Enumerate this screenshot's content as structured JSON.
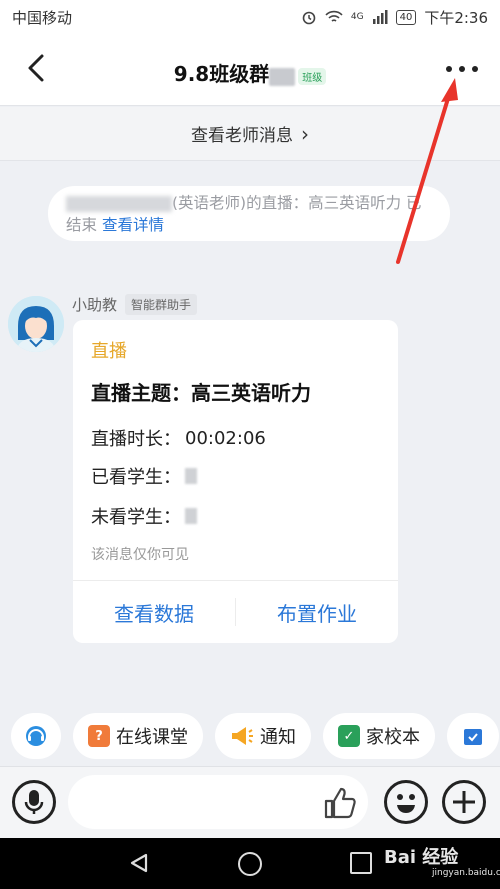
{
  "status": {
    "carrier": "中国移动",
    "battery": "40",
    "time": "下午2:36",
    "network": "4G"
  },
  "header": {
    "title": "9.8班级群",
    "class_tag": "班级"
  },
  "teacher_bar": {
    "label": "查看老师消息",
    "chevron": "›"
  },
  "notice": {
    "text": "(英语老师)的直播：高三英语听力 已结束",
    "link": "查看详情"
  },
  "message": {
    "sender": "小助教",
    "sender_tag": "智能群助手",
    "card_tag": "直播",
    "card_title": "直播主题：高三英语听力",
    "duration_label": "直播时长：",
    "duration_value": "00:02:06",
    "watched_label": "已看学生：",
    "unwatched_label": "未看学生：",
    "note": "该消息仅你可见",
    "action_data": "查看数据",
    "action_homework": "布置作业"
  },
  "quickbar": {
    "items": [
      {
        "label": "在线课堂",
        "color": "#f07b3a"
      },
      {
        "label": "通知",
        "color": "#f5a623"
      },
      {
        "label": "家校本",
        "color": "#2aa05a"
      }
    ]
  },
  "icons": {
    "back": "back-arrow-icon",
    "more": "more-dots-icon",
    "mic": "microphone-icon",
    "thumb": "thumbs-up-icon",
    "emoji": "smiley-icon",
    "plus": "plus-icon"
  },
  "watermark": {
    "brand": "Bai 经验",
    "url": "jingyan.baidu.com"
  },
  "colors": {
    "accent_blue": "#2b78d8",
    "live_tag": "#e6a72a",
    "annotation_red": "#e8342b"
  }
}
